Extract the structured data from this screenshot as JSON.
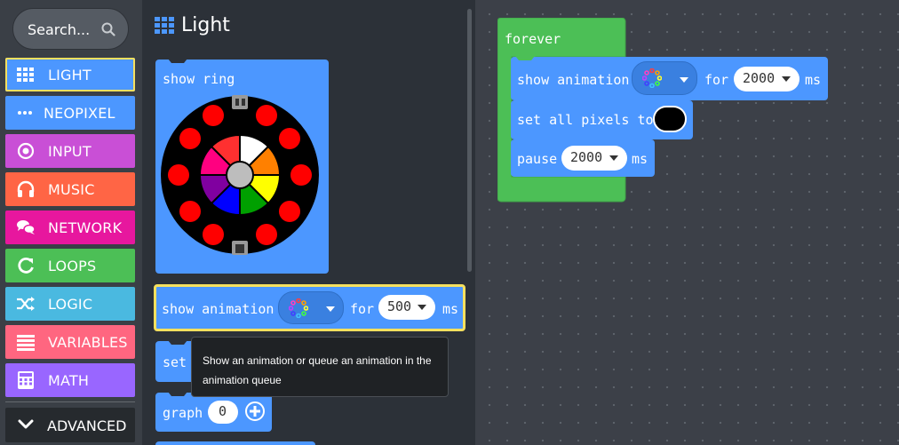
{
  "search": {
    "placeholder": "Search..."
  },
  "categories": [
    {
      "label": "LIGHT",
      "color": "#4c97ff",
      "icon": "grid-icon",
      "selected": true
    },
    {
      "label": "NEOPIXEL",
      "color": "#4c97ff",
      "icon": "neopixel-dots-icon"
    },
    {
      "label": "INPUT",
      "color": "#c94fd6",
      "icon": "radio-target-icon"
    },
    {
      "label": "MUSIC",
      "color": "#ff6545",
      "icon": "headphones-icon"
    },
    {
      "label": "NETWORK",
      "color": "#e7179e",
      "icon": "chat-bubbles-icon"
    },
    {
      "label": "LOOPS",
      "color": "#4cbf56",
      "icon": "refresh-loop-icon"
    },
    {
      "label": "LOGIC",
      "color": "#4ab9e0",
      "icon": "shuffle-icon"
    },
    {
      "label": "VARIABLES",
      "color": "#ff6680",
      "icon": "list-lines-icon"
    },
    {
      "label": "MATH",
      "color": "#9966ff",
      "icon": "calculator-icon"
    }
  ],
  "advanced": {
    "label": "ADVANCED",
    "icon": "chevron-down-icon"
  },
  "flyout": {
    "title": "Light",
    "title_icon": "grid-icon",
    "show_ring": {
      "label": "show ring"
    },
    "show_animation": {
      "label": "show animation",
      "for_label": "for",
      "duration": "500",
      "unit": "ms"
    },
    "set_label": "set",
    "graph": {
      "label": "graph",
      "value": "0"
    },
    "tooltip": "Show an animation or queue an animation in the animation queue"
  },
  "workspace": {
    "forever_label": "forever",
    "show_animation": {
      "label": "show animation",
      "for_label": "for",
      "duration": "2000",
      "unit": "ms"
    },
    "set_all_pixels": {
      "label": "set all pixels to",
      "color": "#000000"
    },
    "pause": {
      "label": "pause",
      "duration": "2000",
      "unit": "ms"
    }
  },
  "colors": {
    "light_block": "#4c97ff",
    "loops_block": "#4cbf56",
    "selected_outline": "#f6e05e",
    "ring_leds": "#ff0000"
  }
}
